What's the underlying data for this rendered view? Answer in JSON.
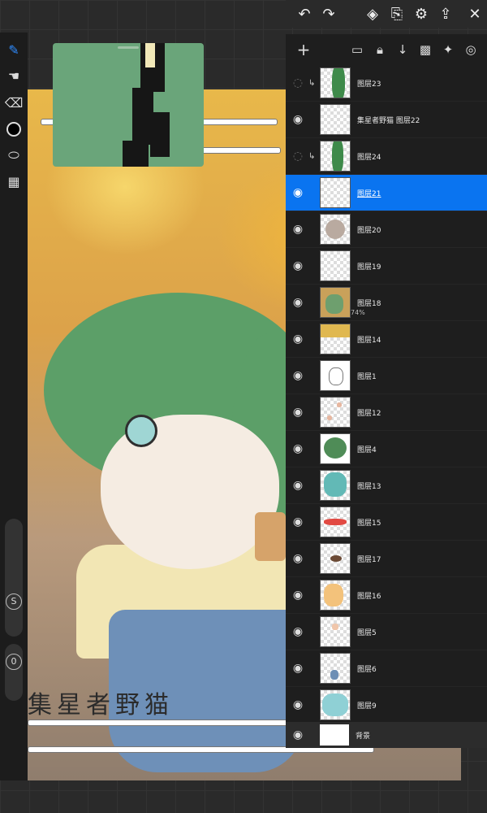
{
  "top_bar": {
    "undo": "undo-icon",
    "redo": "redo-icon",
    "layers": "layers-icon",
    "import": "import-icon",
    "settings": "gear-icon",
    "share": "share-icon",
    "close": "close-icon"
  },
  "layers_toolbar": {
    "add": "+",
    "icons": [
      "folder-icon",
      "lock-icon",
      "merge-down-icon",
      "alpha-lock-icon",
      "pin-icon",
      "target-icon"
    ]
  },
  "layers": [
    {
      "name": "图层23",
      "visible": false,
      "clipped": true
    },
    {
      "name": "集星者野猫",
      "visible": true,
      "clipped": false,
      "full_name": "集星者野猫 图层22"
    },
    {
      "name": "图层24",
      "visible": false,
      "clipped": true
    },
    {
      "name": "图层21",
      "visible": true,
      "clipped": false,
      "selected": true
    },
    {
      "name": "图层20",
      "visible": true,
      "clipped": false
    },
    {
      "name": "图层19",
      "visible": true,
      "clipped": false
    },
    {
      "name": "图层18",
      "visible": true,
      "clipped": false,
      "opacity": "74%"
    },
    {
      "name": "图层14",
      "visible": true,
      "clipped": false
    },
    {
      "name": "图层1",
      "visible": true,
      "clipped": false
    },
    {
      "name": "图层12",
      "visible": true,
      "clipped": false
    },
    {
      "name": "图层4",
      "visible": true,
      "clipped": false
    },
    {
      "name": "图层13",
      "visible": true,
      "clipped": false
    },
    {
      "name": "图层15",
      "visible": true,
      "clipped": false
    },
    {
      "name": "图层17",
      "visible": true,
      "clipped": false
    },
    {
      "name": "图层16",
      "visible": true,
      "clipped": false
    },
    {
      "name": "图层5",
      "visible": true,
      "clipped": false
    },
    {
      "name": "图层6",
      "visible": true,
      "clipped": false
    },
    {
      "name": "图层9",
      "visible": true,
      "clipped": false
    }
  ],
  "background_layer": {
    "name": "背景"
  },
  "canvas": {
    "caption": "集星者野猫"
  },
  "tools": {
    "brush": "brush-icon",
    "smudge": "smudge-icon",
    "eraser": "eraser-icon",
    "color": "#000000",
    "lasso": "lasso-icon",
    "panels": "grid-icon",
    "size_label": "S",
    "opacity_label": "0"
  },
  "colors": {
    "accent": "#0a74f0",
    "hair": "#5c9f68"
  }
}
